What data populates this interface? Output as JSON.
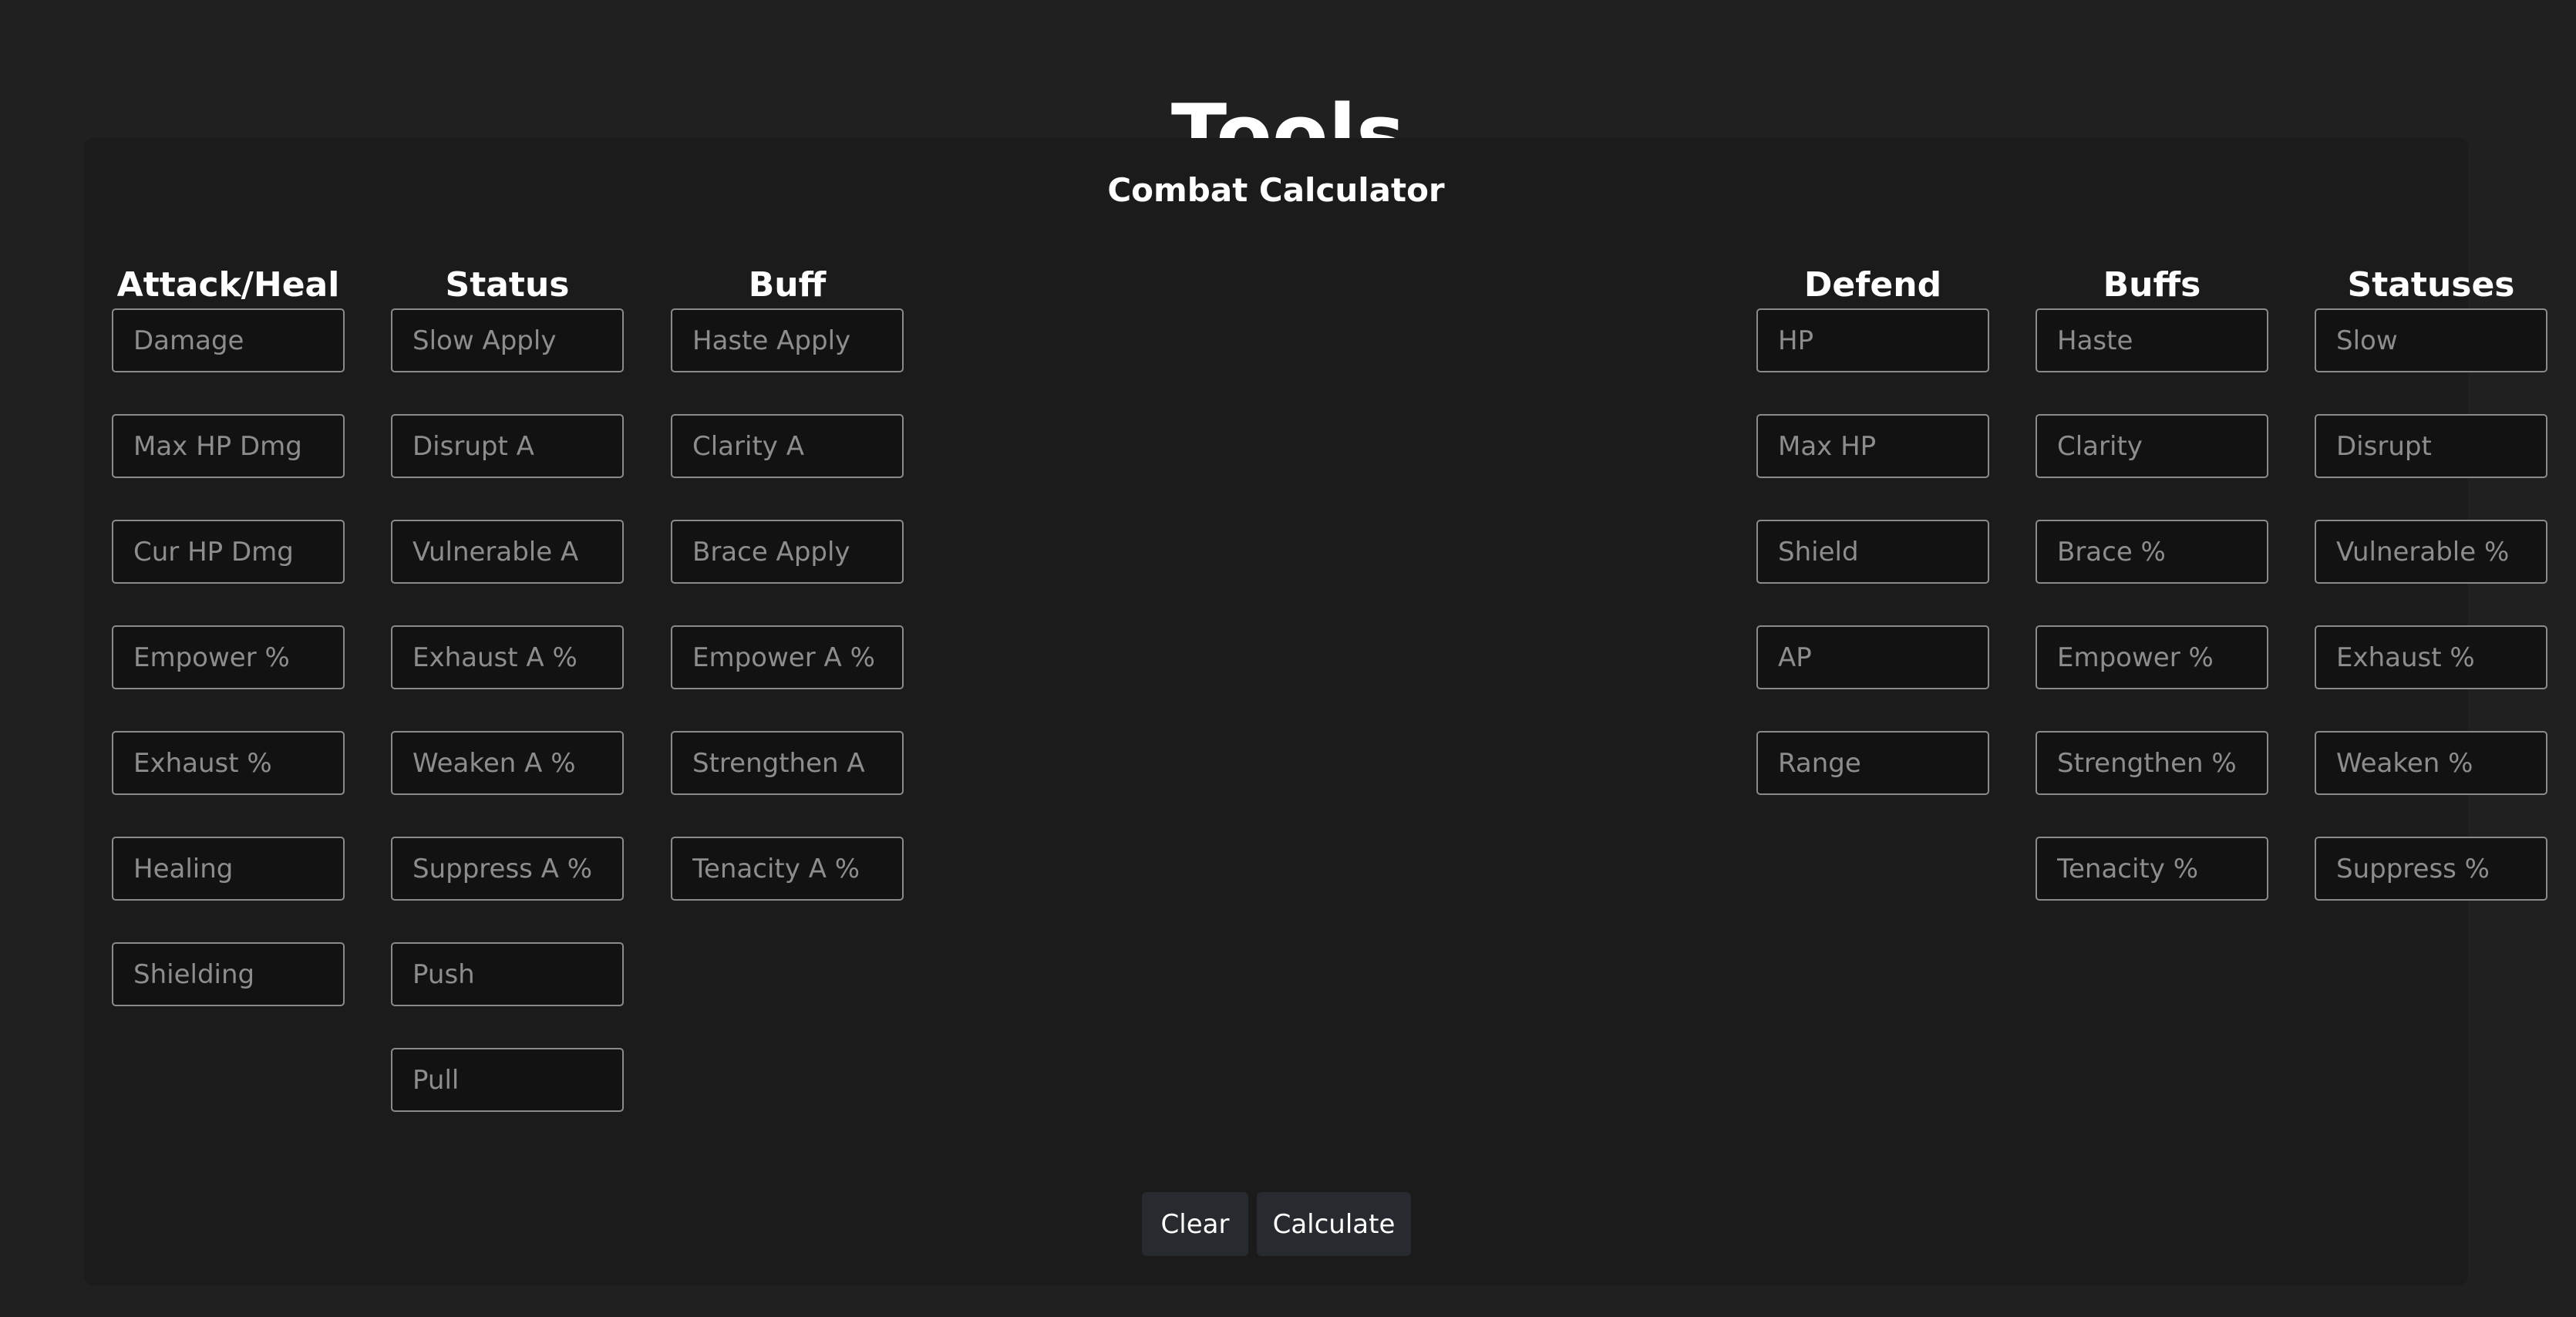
{
  "page": {
    "title": "Tools"
  },
  "calculator": {
    "title": "Combat Calculator",
    "columns": [
      {
        "header": "Attack/Heal",
        "fields": [
          "Damage",
          "Max HP Dmg",
          "Cur HP Dmg",
          "Empower %",
          "Exhaust %",
          "Healing",
          "Shielding"
        ]
      },
      {
        "header": "Status",
        "fields": [
          "Slow Apply",
          "Disrupt A",
          "Vulnerable A",
          "Exhaust A %",
          "Weaken A %",
          "Suppress A %",
          "Push",
          "Pull"
        ]
      },
      {
        "header": "Buff",
        "fields": [
          "Haste Apply",
          "Clarity A",
          "Brace Apply",
          "Empower A %",
          "Strengthen A",
          "Tenacity A %"
        ]
      },
      {
        "header": "Defend",
        "fields": [
          "HP",
          "Max HP",
          "Shield",
          "AP",
          "Range"
        ]
      },
      {
        "header": "Buffs",
        "fields": [
          "Haste",
          "Clarity",
          "Brace %",
          "Empower %",
          "Strengthen %",
          "Tenacity %"
        ]
      },
      {
        "header": "Statuses",
        "fields": [
          "Slow",
          "Disrupt",
          "Vulnerable %",
          "Exhaust %",
          "Weaken %",
          "Suppress %"
        ]
      }
    ],
    "buttons": {
      "clear": "Clear",
      "calculate": "Calculate"
    }
  }
}
